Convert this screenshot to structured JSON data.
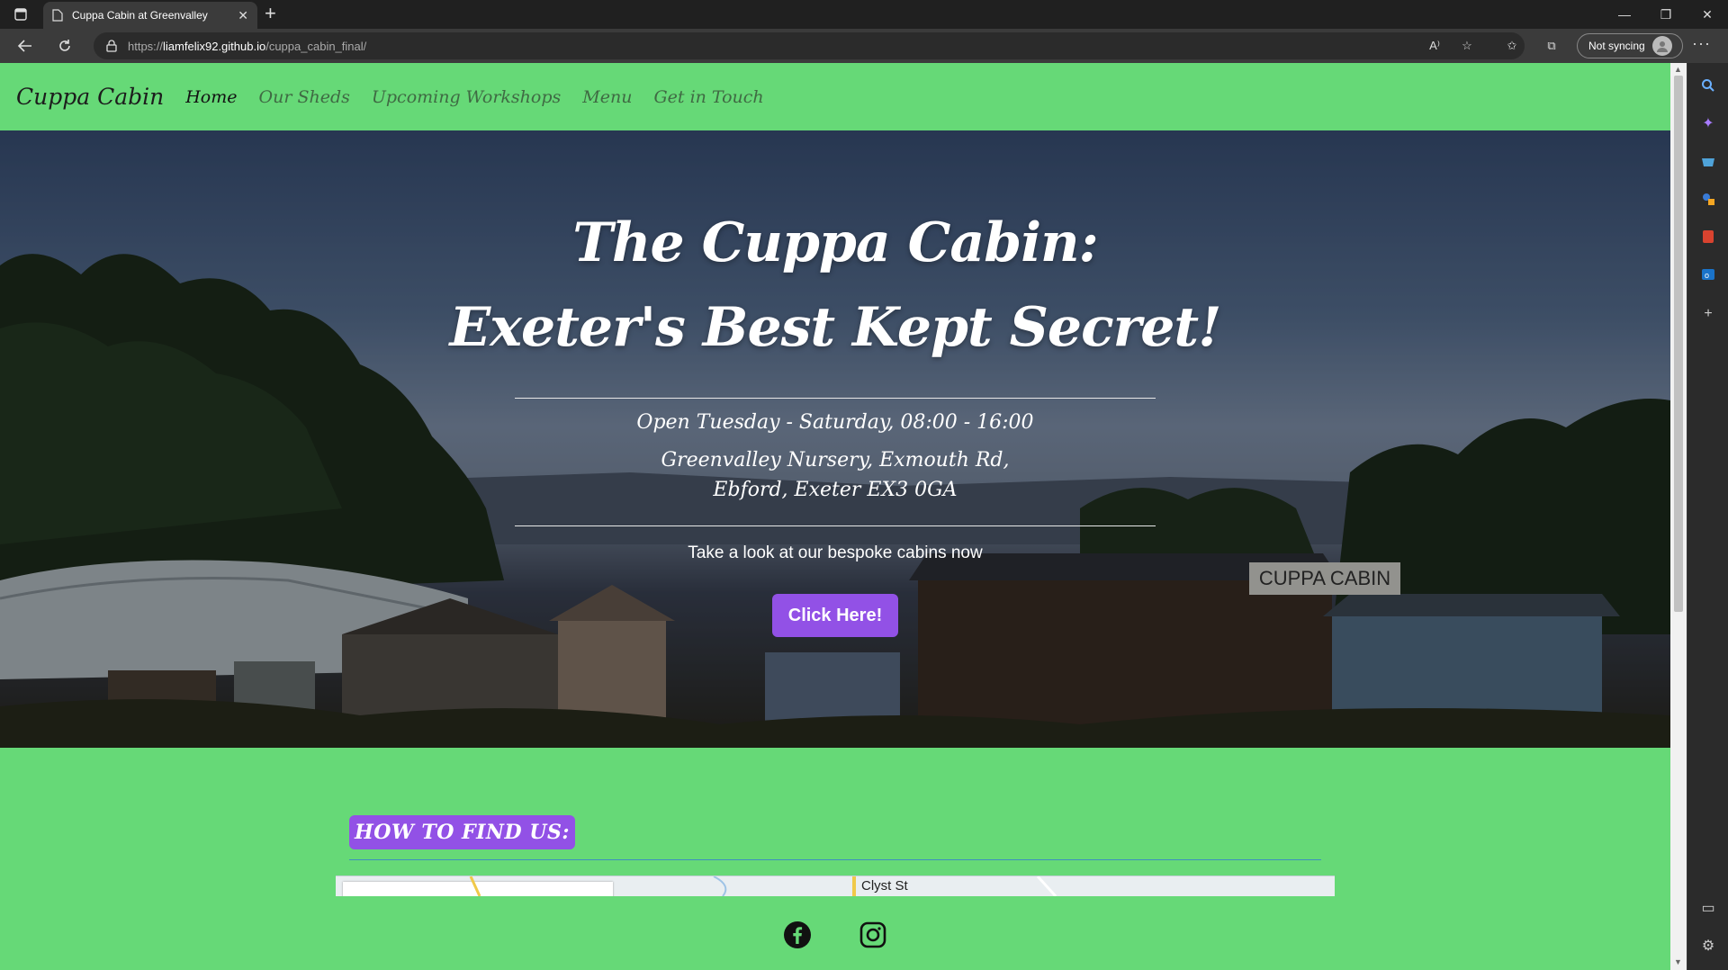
{
  "browser": {
    "tab_title": "Cuppa Cabin at Greenvalley",
    "new_tab_symbol": "+",
    "url_prefix": "https://",
    "url_host": "liamfelix92.github.io",
    "url_path": "/cuppa_cabin_final/",
    "sync_label": "Not syncing",
    "more_label": "···",
    "read_aloud_label": "A⁾"
  },
  "site": {
    "brand": "Cuppa Cabin",
    "nav": [
      {
        "label": "Home",
        "active": true
      },
      {
        "label": "Our Sheds"
      },
      {
        "label": "Upcoming Workshops"
      },
      {
        "label": "Menu"
      },
      {
        "label": "Get in Touch"
      }
    ]
  },
  "hero": {
    "title_line1": "The Cuppa Cabin:",
    "title_line2": "Exeter's Best Kept Secret!",
    "hours": "Open Tuesday - Saturday, 08:00 - 16:00",
    "address_line1": "Greenvalley Nursery, Exmouth Rd,",
    "address_line2": "Ebford, Exeter EX3 0GA",
    "cta_text": "Take a look at our bespoke cabins now",
    "cta_button": "Click Here!",
    "sign_text": "CUPPA CABIN"
  },
  "find_us": {
    "heading": "HOW TO FIND US:",
    "map_road_label": "Clyst St"
  },
  "socials": [
    "facebook-icon",
    "instagram-icon"
  ],
  "colors": {
    "page_green": "#66d977",
    "accent_purple": "#9251e6",
    "chrome_dark": "#202020"
  }
}
